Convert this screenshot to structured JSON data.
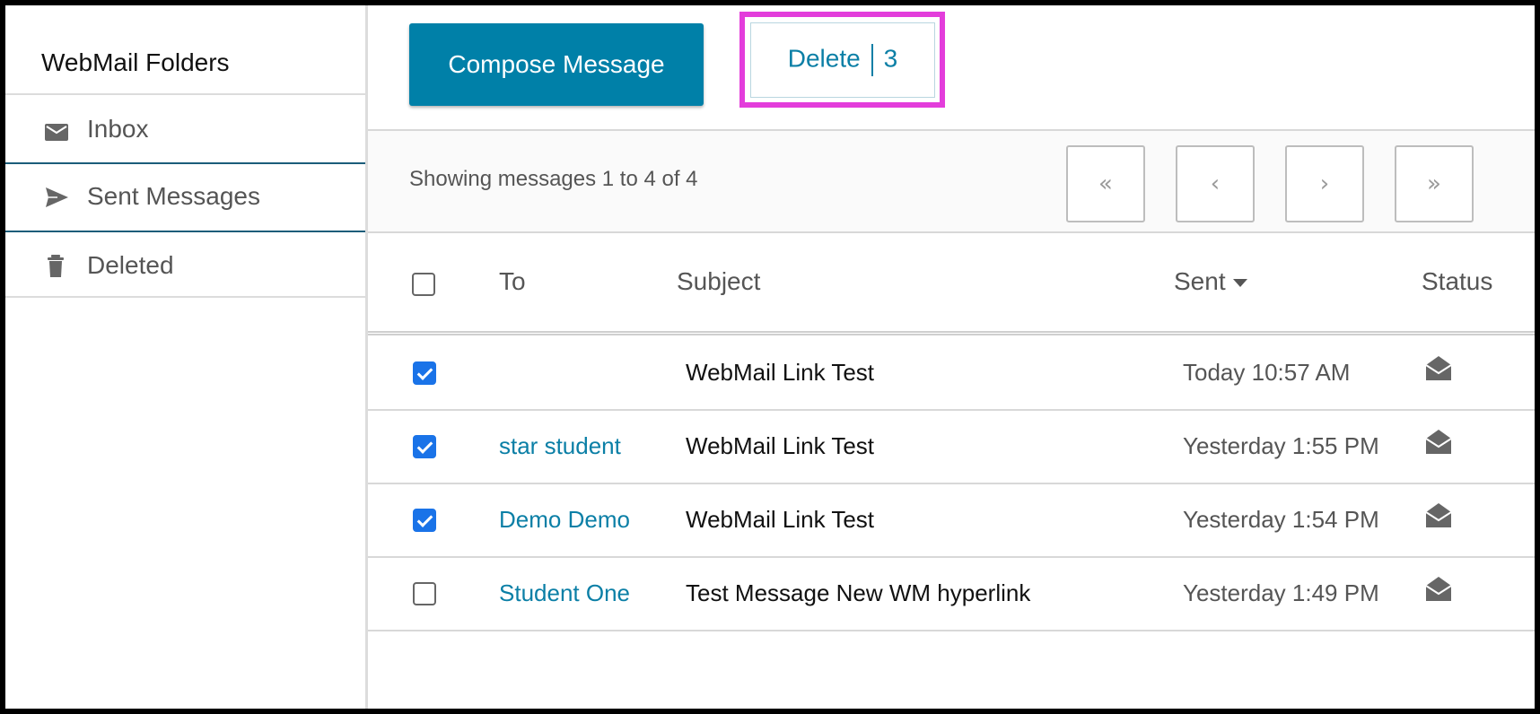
{
  "sidebar": {
    "title": "WebMail Folders",
    "items": [
      {
        "label": "Inbox",
        "icon": "envelope-icon",
        "active": false
      },
      {
        "label": "Sent Messages",
        "icon": "send-icon",
        "active": true
      },
      {
        "label": "Deleted",
        "icon": "trash-icon",
        "active": false
      }
    ]
  },
  "toolbar": {
    "compose_label": "Compose Message",
    "delete_label": "Delete",
    "delete_count": "3"
  },
  "pager": {
    "summary": "Showing messages 1 to 4 of 4",
    "first": "«",
    "prev": "‹",
    "next": "›",
    "last": "»"
  },
  "table": {
    "columns": {
      "to": "To",
      "subject": "Subject",
      "sent": "Sent",
      "status": "Status"
    },
    "sort_column": "Sent",
    "sort_direction": "descending",
    "select_all_checked": false,
    "rows": [
      {
        "checked": true,
        "to": "",
        "subject": "WebMail Link Test",
        "sent": "Today 10:57 AM",
        "status_icon": "envelope-open-icon"
      },
      {
        "checked": true,
        "to": "star student",
        "subject": "WebMail Link Test",
        "sent": "Yesterday 1:55 PM",
        "status_icon": "envelope-open-icon"
      },
      {
        "checked": true,
        "to": "Demo Demo",
        "subject": "WebMail Link Test",
        "sent": "Yesterday 1:54 PM",
        "status_icon": "envelope-open-icon"
      },
      {
        "checked": false,
        "to": "Student One",
        "subject": "Test Message New WM hyperlink",
        "sent": "Yesterday 1:49 PM",
        "status_icon": "envelope-open-icon"
      }
    ]
  },
  "colors": {
    "accent": "#0080a8",
    "link": "#0b7fa6",
    "highlight": "#e33ddb",
    "checkbox": "#1a73e8"
  }
}
